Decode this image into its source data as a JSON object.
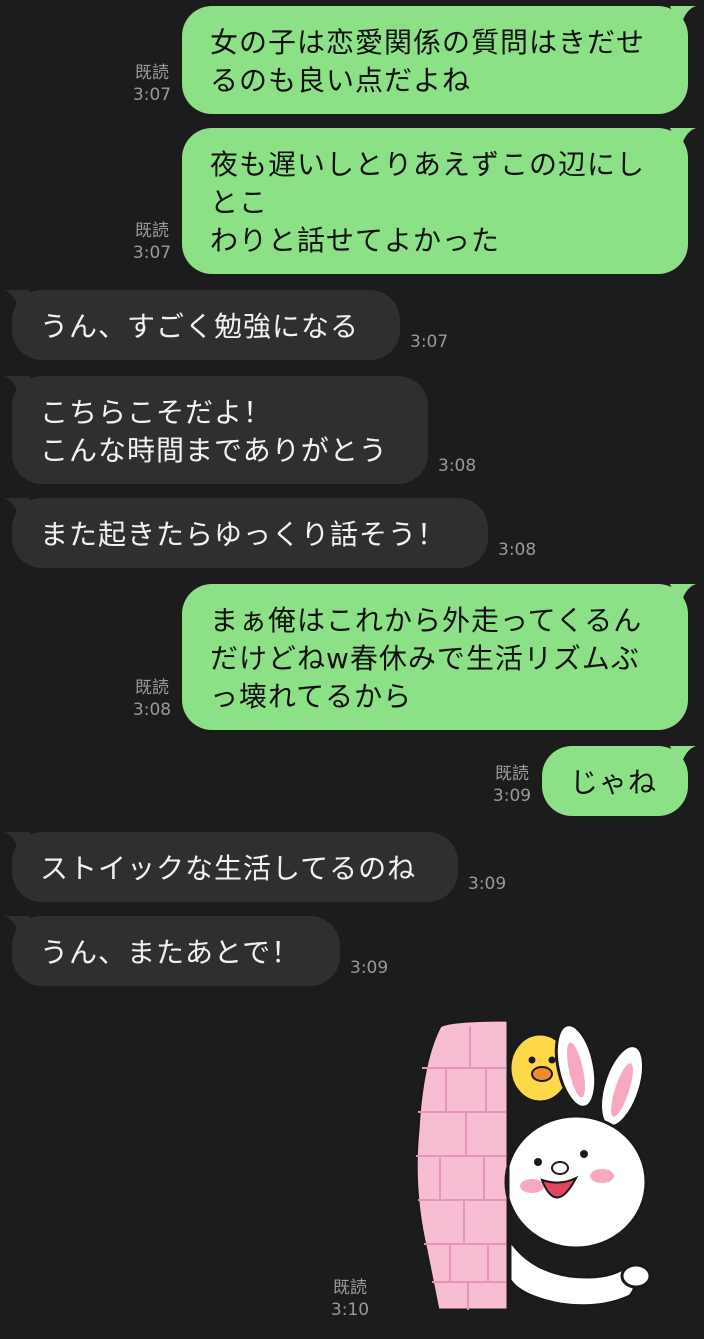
{
  "read_label": "既読",
  "messages": [
    {
      "id": "m1",
      "side": "out",
      "text": "女の子は恋愛関係の質問はきだせ\nるのも良い点だよね",
      "time": "3:07"
    },
    {
      "id": "m2",
      "side": "out",
      "text": "夜も遅いしとりあえずこの辺にし\nとこ\nわりと話せてよかった",
      "time": "3:07"
    },
    {
      "id": "m3",
      "side": "in",
      "text": "うん、すごく勉強になる",
      "time": "3:07"
    },
    {
      "id": "m4",
      "side": "in",
      "text": "こちらこそだよ！\nこんな時間までありがとう",
      "time": "3:08"
    },
    {
      "id": "m5",
      "side": "in",
      "text": "また起きたらゆっくり話そう！",
      "time": "3:08"
    },
    {
      "id": "m6",
      "side": "out",
      "text": "まぁ俺はこれから外走ってくるん\nだけどねw春休みで生活リズムぶ\nっ壊れてるから",
      "time": "3:08"
    },
    {
      "id": "m7",
      "side": "out",
      "text": "じゃね",
      "time": "3:09"
    },
    {
      "id": "m8",
      "side": "in",
      "text": "ストイックな生活してるのね",
      "time": "3:09"
    },
    {
      "id": "m9",
      "side": "in",
      "text": "うん、またあとで！",
      "time": "3:09"
    }
  ],
  "sticker": {
    "icon": "cony-peeking-sticker",
    "time": "3:10"
  },
  "colors": {
    "outgoing": "#8ce086",
    "incoming": "#2f2f2f",
    "background": "#1c1c1c"
  }
}
